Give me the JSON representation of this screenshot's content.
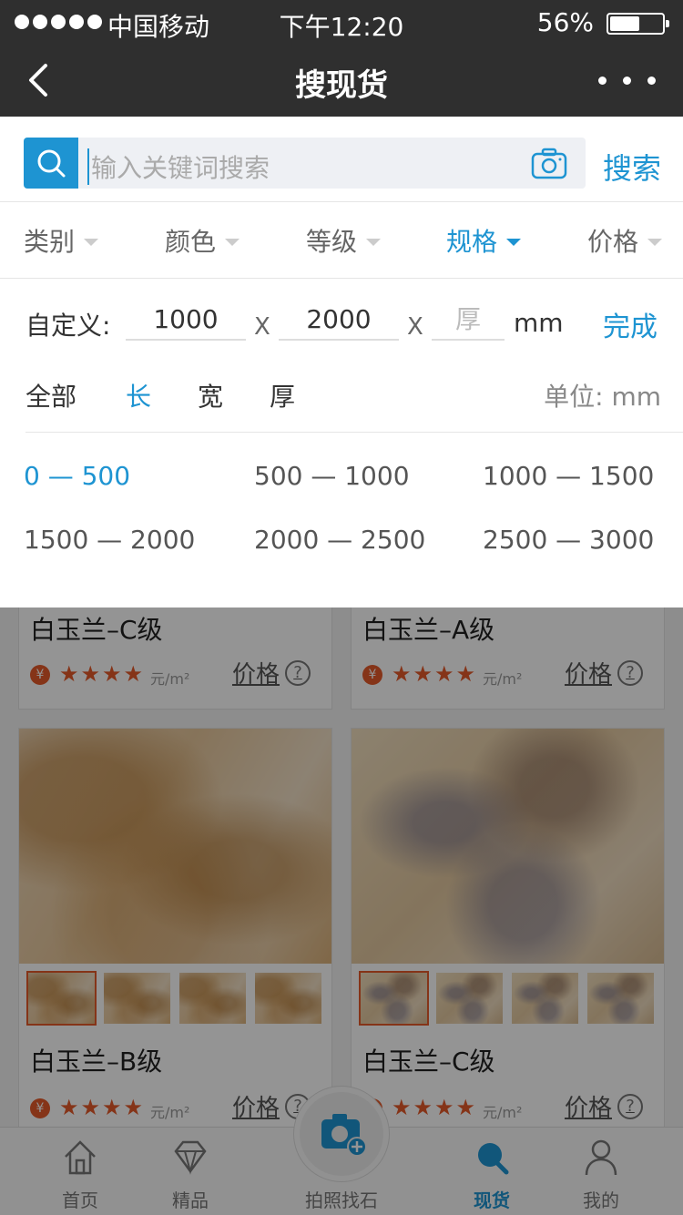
{
  "status_bar": {
    "carrier": "中国移动",
    "time": "下午12:20",
    "battery": "56%",
    "battery_level": 0.56
  },
  "nav": {
    "title": "搜现货"
  },
  "search": {
    "placeholder": "输入关键词搜索",
    "button_label": "搜索"
  },
  "filters": [
    {
      "label": "类别",
      "active": false
    },
    {
      "label": "颜色",
      "active": false
    },
    {
      "label": "等级",
      "active": false
    },
    {
      "label": "规格",
      "active": true
    },
    {
      "label": "价格",
      "active": false
    }
  ],
  "spec_panel": {
    "custom_label": "自定义:",
    "length_value": "1000",
    "width_value": "2000",
    "thickness_placeholder": "厚",
    "times_sign": "X",
    "unit": "mm",
    "done_label": "完成",
    "dimension_options": [
      {
        "label": "全部",
        "active": false
      },
      {
        "label": "长",
        "active": true
      },
      {
        "label": "宽",
        "active": false
      },
      {
        "label": "厚",
        "active": false
      }
    ],
    "unit_label": "单位: mm",
    "ranges": [
      {
        "label": "0 — 500",
        "active": true
      },
      {
        "label": "500 — 1000",
        "active": false
      },
      {
        "label": "1000 — 1500",
        "active": false
      },
      {
        "label": "1500 — 2000",
        "active": false
      },
      {
        "label": "2000 — 2500",
        "active": false
      },
      {
        "label": "2500 — 3000",
        "active": false
      }
    ]
  },
  "products": [
    {
      "name": "白玉兰–C级",
      "stars": "★★★★",
      "unit": "元/m²",
      "price_label": "价格"
    },
    {
      "name": "白玉兰–A级",
      "stars": "★★★★",
      "unit": "元/m²",
      "price_label": "价格"
    },
    {
      "name": "白玉兰–B级",
      "stars": "★★★★",
      "unit": "元/m²",
      "price_label": "价格"
    },
    {
      "name": "白玉兰–C级",
      "stars": "★★★★",
      "unit": "元/m²",
      "price_label": "价格"
    }
  ],
  "currency_symbol": "¥",
  "help_symbol": "?",
  "tabs": [
    {
      "label": "首页",
      "icon": "home-icon",
      "active": false
    },
    {
      "label": "精品",
      "icon": "diamond-icon",
      "active": false
    },
    {
      "label": "拍照找石",
      "icon": "camera-plus-icon",
      "active": false
    },
    {
      "label": "现货",
      "icon": "search-icon",
      "active": true
    },
    {
      "label": "我的",
      "icon": "user-icon",
      "active": false
    }
  ],
  "colors": {
    "accent": "#1e94d2",
    "header_bg": "#2f2f2f",
    "star": "#e55a2a"
  }
}
